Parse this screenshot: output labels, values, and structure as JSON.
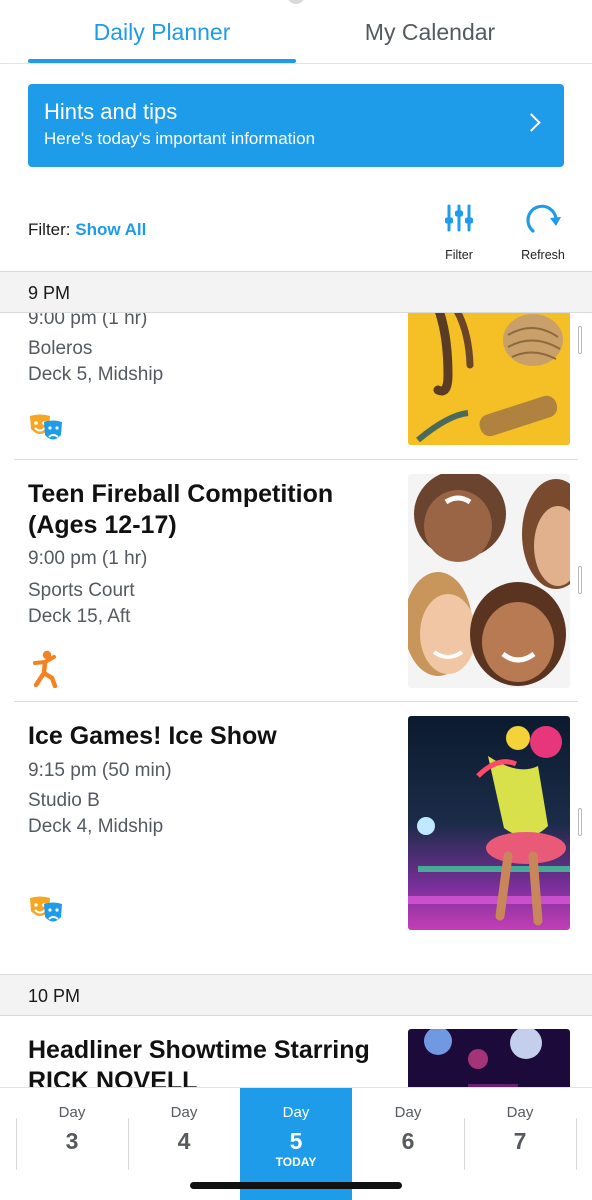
{
  "tabs": {
    "planner": "Daily Planner",
    "calendar": "My Calendar"
  },
  "hints": {
    "title": "Hints and tips",
    "subtitle": "Here's today's important information"
  },
  "filter": {
    "prefix": "Filter:",
    "value": "Show All",
    "filter_label": "Filter",
    "refresh_label": "Refresh"
  },
  "sections": {
    "first": "9 PM",
    "second": "10 PM"
  },
  "events": [
    {
      "title": "",
      "time": "9:00 pm (1 hr)",
      "venue": "Boleros",
      "location": "Deck 5, Midship",
      "icon": "theater-masks-icon"
    },
    {
      "title": "Teen Fireball Competition (Ages 12-17)",
      "time": "9:00 pm (1 hr)",
      "venue": "Sports Court",
      "location": "Deck 15, Aft",
      "icon": "activity-person-icon"
    },
    {
      "title": "Ice Games! Ice Show",
      "time": "9:15 pm (50 min)",
      "venue": "Studio B",
      "location": "Deck 4, Midship",
      "icon": "theater-masks-icon"
    },
    {
      "title": "Headliner Showtime Starring RICK NOVELL"
    }
  ],
  "days": [
    {
      "word": "Day",
      "num": "3",
      "today": ""
    },
    {
      "word": "Day",
      "num": "4",
      "today": ""
    },
    {
      "word": "Day",
      "num": "5",
      "today": "TODAY"
    },
    {
      "word": "Day",
      "num": "6",
      "today": ""
    },
    {
      "word": "Day",
      "num": "7",
      "today": ""
    }
  ],
  "colors": {
    "accent": "#1e9be9",
    "icon_orange": "#f58220",
    "text_gray": "#555a60"
  }
}
